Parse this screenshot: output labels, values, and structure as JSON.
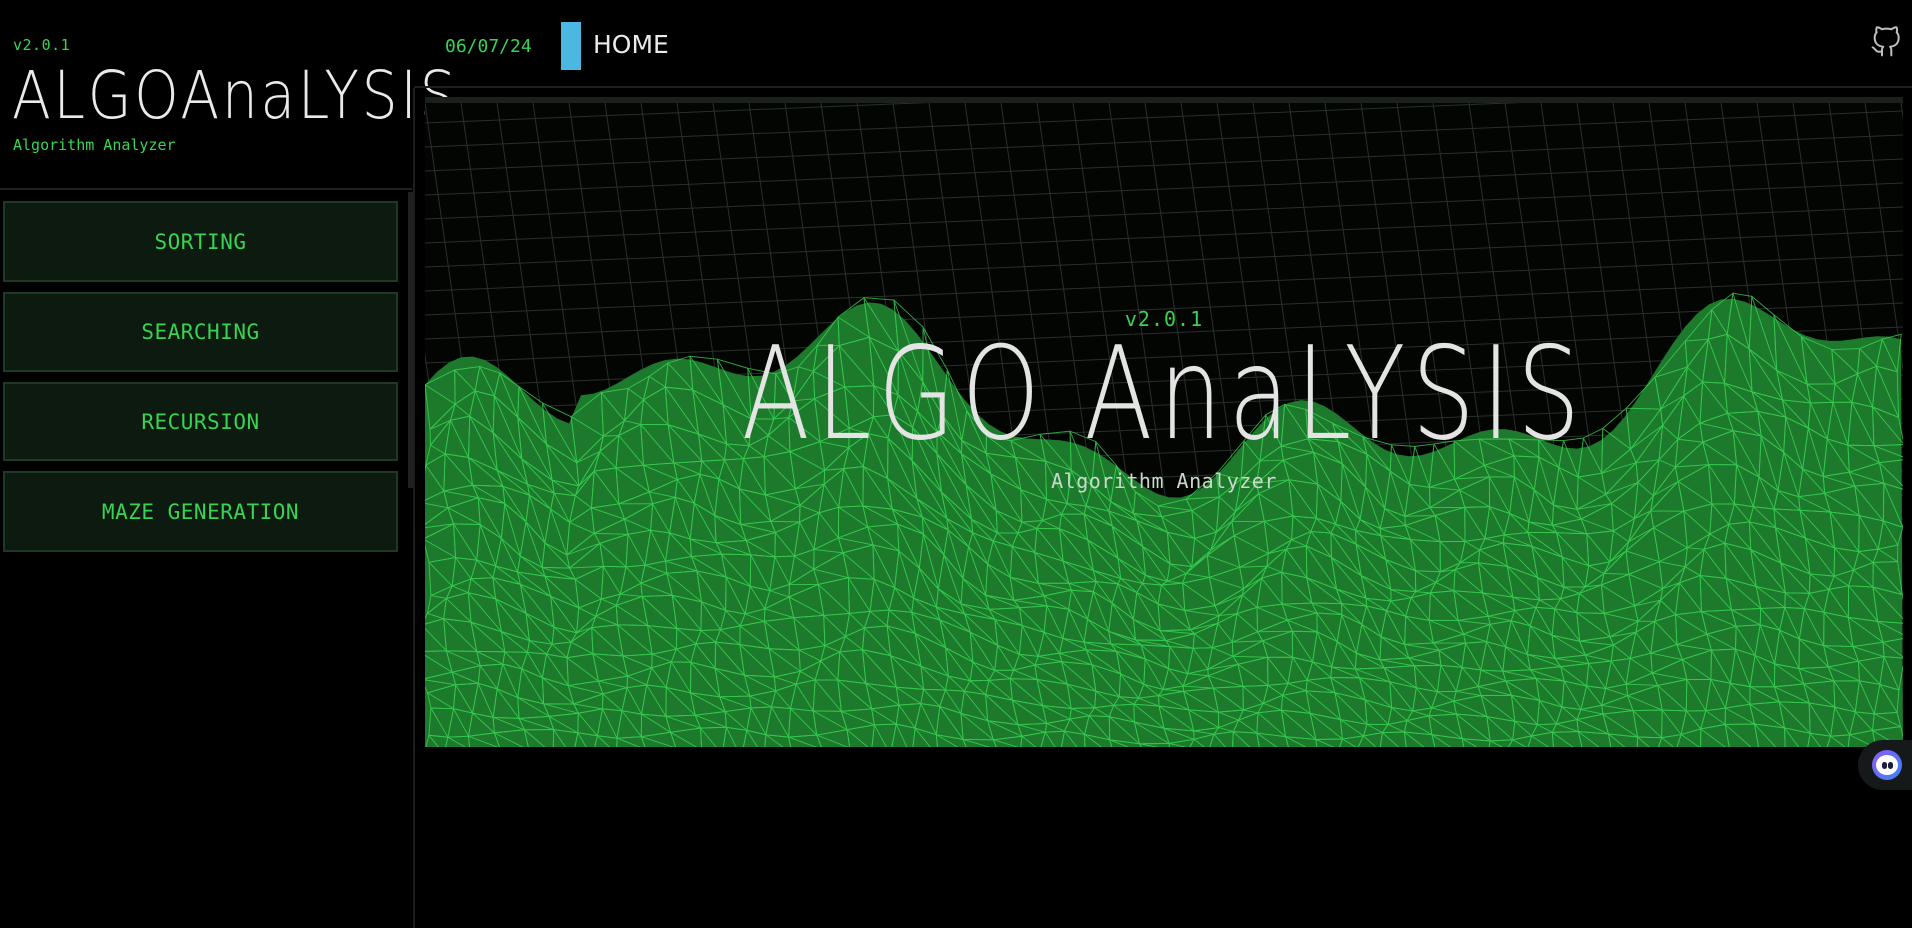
{
  "sidebar": {
    "version": "v2.0.1",
    "logo": "ALGOAnaLYSIS",
    "subtitle": "Algorithm Analyzer",
    "nav": [
      {
        "label": "SORTING"
      },
      {
        "label": "SEARCHING"
      },
      {
        "label": "RECURSION"
      },
      {
        "label": "MAZE GENERATION"
      }
    ]
  },
  "header": {
    "date": "06/07/24",
    "page": "HOME",
    "github_icon": "github-icon",
    "marker_color": "#4ab8e0"
  },
  "hero": {
    "version": "v2.0.1",
    "title": "ALGO AnaLYSIS",
    "subtitle": "Algorithm Analyzer"
  },
  "colors": {
    "accent": "#39d353",
    "background": "#000000",
    "panel": "#0d1a0f",
    "text": "#eaeaea"
  },
  "assistant": {
    "icon": "assistant-bot-icon"
  }
}
